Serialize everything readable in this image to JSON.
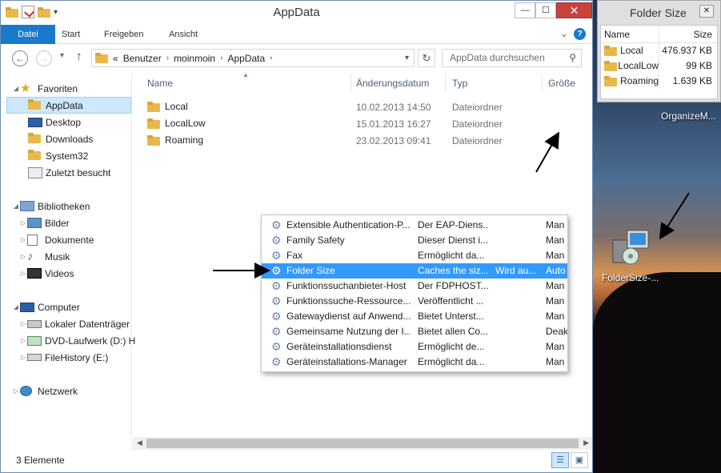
{
  "window": {
    "title": "AppData",
    "minimize": "—",
    "maximize": "☐",
    "close": "✕"
  },
  "ribbon": {
    "tabs": [
      "Datei",
      "Start",
      "Freigeben",
      "Ansicht"
    ]
  },
  "address": {
    "prefix": "«",
    "crumbs": [
      "Benutzer",
      "moinmoin",
      "AppData"
    ],
    "search_placeholder": "AppData durchsuchen"
  },
  "navpane": {
    "favorites": "Favoriten",
    "fav_items": [
      "AppData",
      "Desktop",
      "Downloads",
      "System32",
      "Zuletzt besucht"
    ],
    "libraries": "Bibliotheken",
    "lib_items": [
      "Bilder",
      "Dokumente",
      "Musik",
      "Videos"
    ],
    "computer": "Computer",
    "comp_items": [
      "Lokaler Datenträger",
      "DVD-Laufwerk (D:) H",
      "FileHistory (E:)"
    ],
    "network": "Netzwerk"
  },
  "columns": {
    "name": "Name",
    "date": "Änderungsdatum",
    "type": "Typ",
    "size": "Größe"
  },
  "files": [
    {
      "name": "Local",
      "date": "10.02.2013 14:50",
      "type": "Dateiordner"
    },
    {
      "name": "LocalLow",
      "date": "15.01.2013 16:27",
      "type": "Dateiordner"
    },
    {
      "name": "Roaming",
      "date": "23.02.2013 09:41",
      "type": "Dateiordner"
    }
  ],
  "status": {
    "count": "3 Elemente"
  },
  "services": [
    {
      "name": "Extensible Authentication-P...",
      "desc": "Der EAP-Diens...",
      "status": "",
      "start": "Man"
    },
    {
      "name": "Family Safety",
      "desc": "Dieser Dienst i...",
      "status": "",
      "start": "Man"
    },
    {
      "name": "Fax",
      "desc": "Ermöglicht da...",
      "status": "",
      "start": "Man"
    },
    {
      "name": "Folder Size",
      "desc": "Caches the siz...",
      "status": "Wird au...",
      "start": "Auto",
      "selected": true
    },
    {
      "name": "Funktionssuchanbieter-Host",
      "desc": "Der FDPHOST...",
      "status": "",
      "start": "Man"
    },
    {
      "name": "Funktionssuche-Ressource...",
      "desc": "Veröffentlicht ...",
      "status": "",
      "start": "Man"
    },
    {
      "name": "Gatewaydienst auf Anwend...",
      "desc": "Bietet Unterst...",
      "status": "",
      "start": "Man"
    },
    {
      "name": "Gemeinsame Nutzung der I...",
      "desc": "Bietet allen Co...",
      "status": "",
      "start": "Deak"
    },
    {
      "name": "Geräteinstallationsdienst",
      "desc": "Ermöglicht de...",
      "status": "",
      "start": "Man"
    },
    {
      "name": "Geräteinstallations-Manager",
      "desc": "Ermöglicht da...",
      "status": "",
      "start": "Man"
    }
  ],
  "folder_size_window": {
    "title": "Folder Size",
    "col_name": "Name",
    "col_size": "Size",
    "rows": [
      {
        "name": "Local",
        "size": "476.937 KB"
      },
      {
        "name": "LocalLow",
        "size": "99 KB"
      },
      {
        "name": "Roaming",
        "size": "1.639 KB"
      }
    ]
  },
  "desktop": {
    "top_label": "OrganizeM...",
    "icon_label": "FolderSize-..."
  },
  "colors": {
    "accent": "#1979ca",
    "selection": "#3399ff",
    "nav_selection": "#cde8ff",
    "close_button": "#c7433c"
  }
}
